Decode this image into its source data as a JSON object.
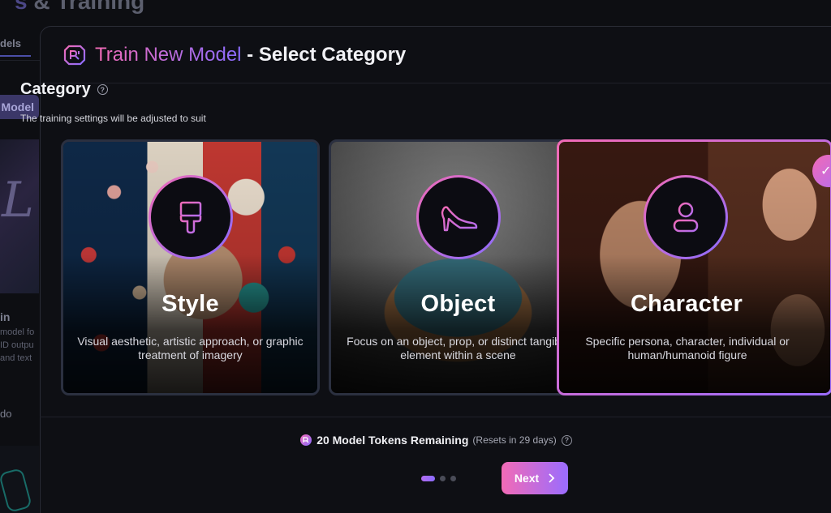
{
  "background": {
    "title_accent": "s",
    "title_rest": " & Training",
    "tab_label": "dels",
    "button_label": "Model",
    "card_title": "in",
    "card_desc_lines": [
      "model fo",
      "ID outpu",
      "and text"
    ],
    "card_tag": "do"
  },
  "modal": {
    "title_gradient": "Train New Model",
    "title_rest": " - Select Category",
    "section_title": "Category",
    "section_subtitle": "The training settings will be adjusted to suit",
    "categories": [
      {
        "name": "Style",
        "description": "Visual aesthetic, artistic approach, or graphic treatment of imagery",
        "icon": "paintbrush-icon",
        "selected": false
      },
      {
        "name": "Object",
        "description": "Focus on an object, prop, or distinct tangible element within a scene",
        "icon": "high-heel-icon",
        "selected": false
      },
      {
        "name": "Character",
        "description": "Specific persona, character, individual or human/humanoid figure",
        "icon": "person-icon",
        "selected": true
      }
    ],
    "tokens_text": "20 Model Tokens Remaining",
    "tokens_reset": "(Resets in 29 days)",
    "next_label": "Next",
    "steps": {
      "total": 3,
      "current": 1
    }
  },
  "colors": {
    "accent_pink": "#f26bb6",
    "accent_purple": "#8a6cff",
    "modal_bg": "#0e0f14"
  }
}
